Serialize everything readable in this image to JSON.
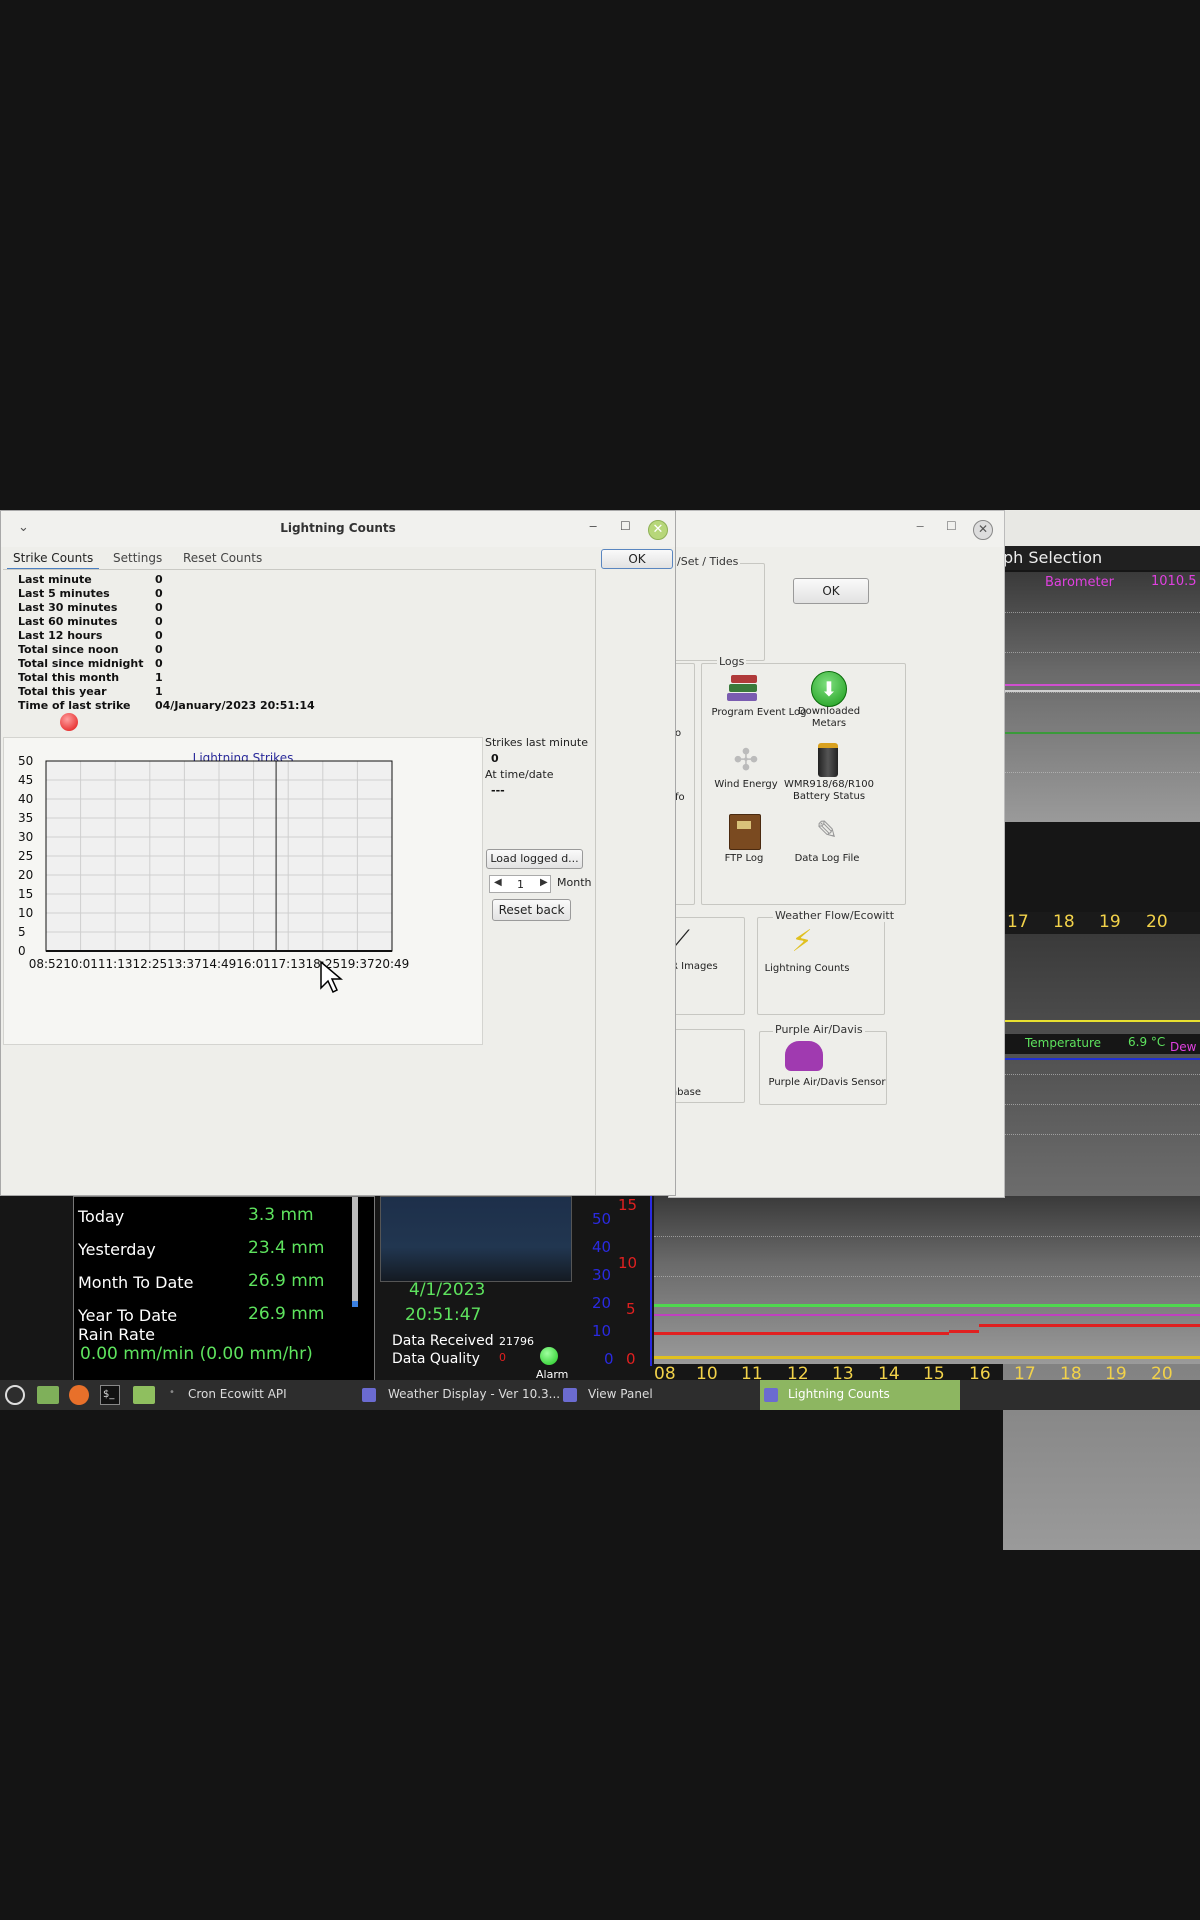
{
  "background": {
    "graph_title": "ph Selection",
    "barometer_label": "Barometer",
    "barometer_value": "1010.5",
    "axis_hours_top": [
      "17",
      "18",
      "19",
      "20"
    ],
    "temperature_label": "Temperature",
    "temperature_value": "6.9 °C",
    "dew_label": "Dew",
    "rain": {
      "rows": [
        {
          "label": "Today",
          "value": "3.3 mm"
        },
        {
          "label": "Yesterday",
          "value": "23.4 mm"
        },
        {
          "label": "Month To Date",
          "value": "26.9 mm"
        },
        {
          "label": "Year To Date",
          "value": "26.9 mm"
        }
      ],
      "rate_label": "Rain Rate",
      "rate_value": "0.00 mm/min (0.00 mm/hr)"
    },
    "date": "4/1/2023",
    "time": "20:51:47",
    "data_received_label": "Data Received",
    "data_received_value": "21796",
    "data_quality_label": "Data Quality",
    "data_quality_value": "0",
    "alarm_label": "Alarm",
    "left_axis": [
      "50",
      "40",
      "30",
      "20",
      "10",
      "0"
    ],
    "right_axis": [
      "15",
      "10",
      "5",
      "0"
    ],
    "axis_hours_bottom": [
      "08",
      "10",
      "11",
      "12",
      "13",
      "14",
      "15",
      "16",
      "17",
      "18",
      "19",
      "20"
    ]
  },
  "view_panel": {
    "ok_label": "OK",
    "set_tides_label": "/Set / Tides",
    "logs_title": "Logs",
    "logs_items": [
      "Program Event Log",
      "Downloaded\nMetars",
      "Wind Energy",
      "WMR918/68/R100\nBattery Status",
      "FTP Log",
      "Data Log File"
    ],
    "partial_labels": [
      "o",
      "fo",
      "R Images",
      "abase"
    ],
    "wf_title": "Weather Flow/Ecowitt",
    "wf_item": "Lightning Counts",
    "pa_title": "Purple Air/Davis",
    "pa_item": "Purple Air/Davis Sensor"
  },
  "lightning": {
    "title": "Lightning Counts",
    "ok_label": "OK",
    "tabs": [
      "Strike Counts",
      "Settings",
      "Reset Counts"
    ],
    "counts": [
      {
        "label": "Last minute",
        "value": "0"
      },
      {
        "label": "Last 5 minutes",
        "value": "0"
      },
      {
        "label": "Last 30 minutes",
        "value": "0"
      },
      {
        "label": "Last 60 minutes",
        "value": "0"
      },
      {
        "label": "Last 12 hours",
        "value": "0"
      },
      {
        "label": "Total since noon",
        "value": "0"
      },
      {
        "label": "Total since midnight",
        "value": "0"
      },
      {
        "label": "Total this month",
        "value": "1"
      },
      {
        "label": "Total this year",
        "value": "1"
      },
      {
        "label": "Time of last strike",
        "value": "04/January/2023 20:51:14"
      }
    ],
    "strikes_last_minute_label": "Strikes last minute",
    "strikes_last_minute_value": "0",
    "at_time_label": "At time/date",
    "at_time_value": "---",
    "load_button_label": "Load logged d...",
    "month_value": "1",
    "month_label": "Month",
    "reset_back_label": "Reset back",
    "chart_data": {
      "type": "line",
      "title": "Lightning Strikes",
      "categories": [
        "08:52",
        "10:01",
        "11:13",
        "12:25",
        "13:37",
        "14:49",
        "16:01",
        "17:13",
        "18:25",
        "19:37",
        "20:49"
      ],
      "y_ticks": [
        "0",
        "5",
        "10",
        "15",
        "20",
        "25",
        "30",
        "35",
        "40",
        "45",
        "50"
      ],
      "ylim": [
        0,
        50
      ],
      "grid": true,
      "series": [
        {
          "values": [
            0,
            0,
            0,
            0,
            0,
            0,
            0,
            0,
            0,
            0,
            0
          ]
        }
      ]
    }
  },
  "taskbar": {
    "items": [
      "Cron Ecowitt API",
      "Weather Display - Ver 10.3...",
      "View Panel",
      "Lightning Counts"
    ],
    "active_color": "#8db661"
  }
}
